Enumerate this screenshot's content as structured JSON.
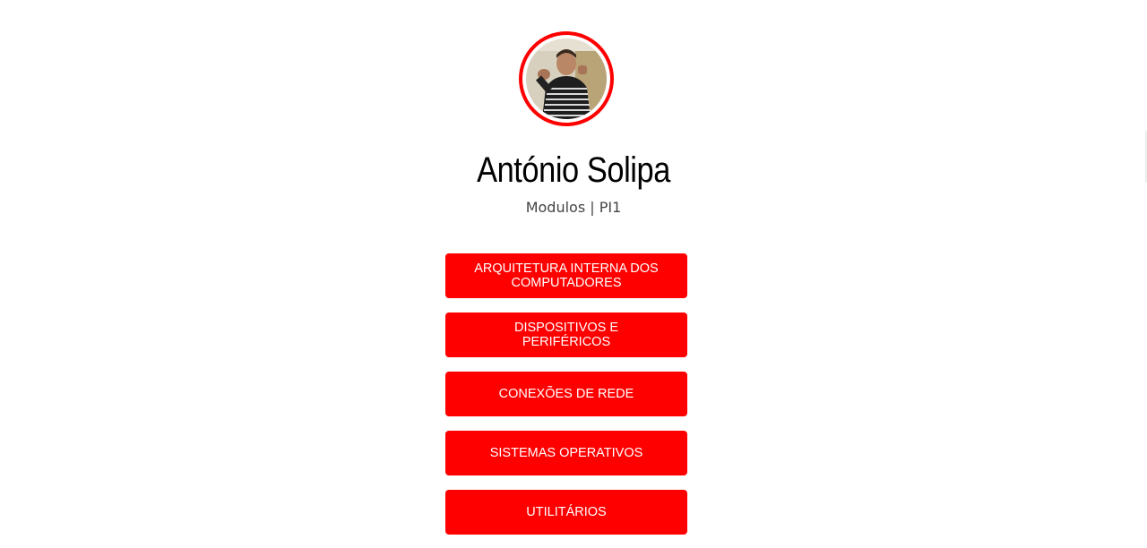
{
  "profile": {
    "name": "António Solipa",
    "subtitle": "Modulos | PI1"
  },
  "colors": {
    "accent": "#ff0000",
    "button_text": "#ffffff",
    "background": "#ffffff"
  },
  "links": [
    {
      "label": "ARQUITETURA INTERNA DOS COMPUTADORES"
    },
    {
      "label": "DISPOSITIVOS E PERIFÉRICOS"
    },
    {
      "label": "CONEXÕES DE REDE"
    },
    {
      "label": "SISTEMAS OPERATIVOS"
    },
    {
      "label": "UTILITÁRIOS"
    }
  ]
}
